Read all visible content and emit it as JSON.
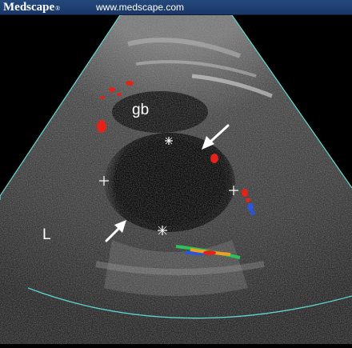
{
  "header": {
    "brand": "Medscape",
    "brand_mark": "®",
    "url": "www.medscape.com"
  },
  "image": {
    "labels": {
      "gallbladder": "gb",
      "liver": "L"
    }
  },
  "colors": {
    "header_bg": "#1f427a",
    "sector_outline": "#5fd3cf",
    "doppler_red": "#e3221a",
    "doppler_blue": "#2b56d6",
    "doppler_green": "#2fbf5a",
    "doppler_orange": "#f0a020"
  }
}
